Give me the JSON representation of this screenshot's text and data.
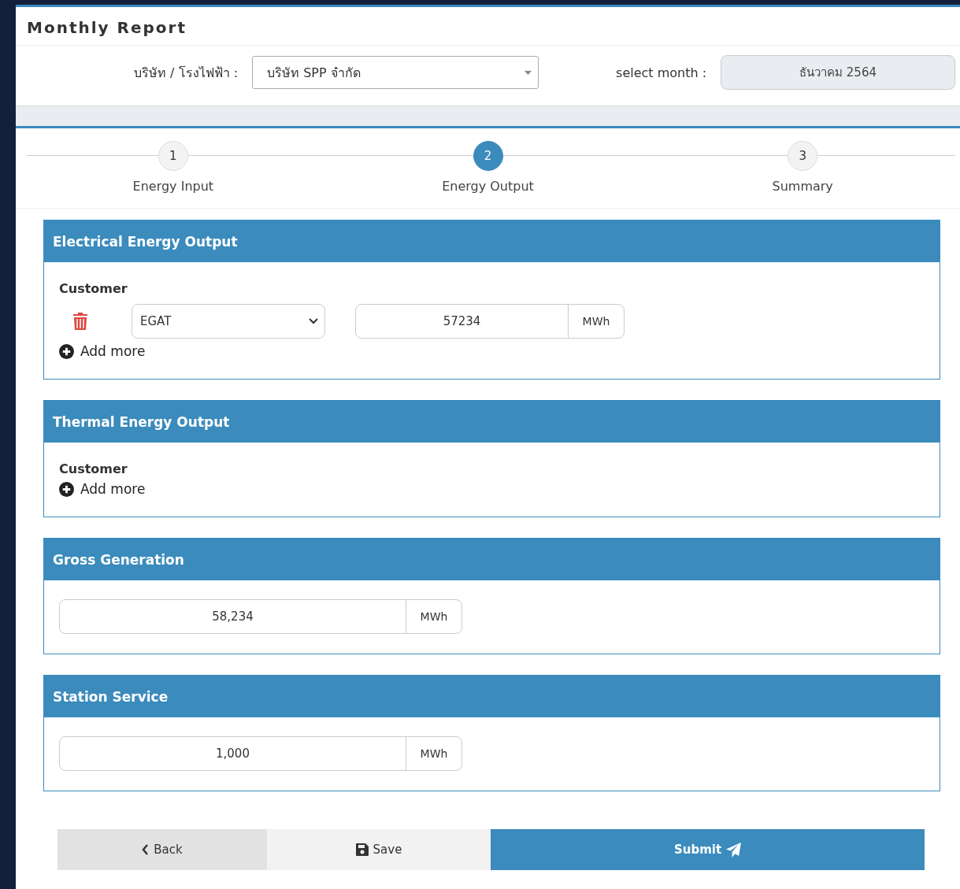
{
  "title": "Monthly Report",
  "filters": {
    "company_label": "บริษัท / โรงไฟฟ้า :",
    "company_value": "บริษัท SPP จำกัด",
    "month_label": "select month :",
    "month_value": "ธันวาคม 2564"
  },
  "steps": [
    {
      "number": "1",
      "label": "Energy Input",
      "selected": false
    },
    {
      "number": "2",
      "label": "Energy Output",
      "selected": true
    },
    {
      "number": "3",
      "label": "Summary",
      "selected": false
    }
  ],
  "sections": [
    {
      "title": "Electrical Energy Output",
      "kind": "customers",
      "customer_label": "Customer",
      "rows": [
        {
          "customer": "EGAT",
          "value": "57234",
          "unit": "MWh"
        }
      ],
      "add_label": "Add more"
    },
    {
      "title": "Thermal Energy Output",
      "kind": "customers",
      "customer_label": "Customer",
      "add_label": "Add more"
    },
    {
      "title": "Gross Generation",
      "kind": "value",
      "value": "58,234",
      "unit": "MWh"
    },
    {
      "title": "Station Service",
      "kind": "value",
      "value": "1,000",
      "unit": "MWh"
    }
  ],
  "buttons": [
    {
      "kind": "back",
      "label": "Back"
    },
    {
      "kind": "save",
      "label": "Save"
    },
    {
      "kind": "submit",
      "label": "Submit"
    }
  ]
}
